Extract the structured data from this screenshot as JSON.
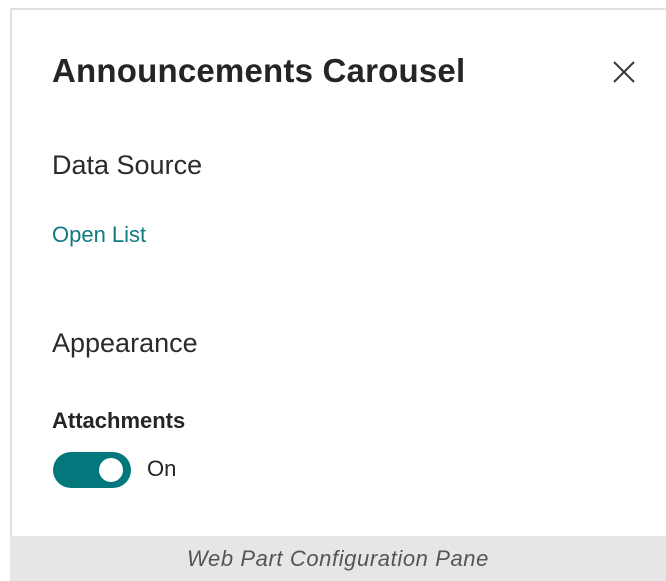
{
  "pane": {
    "title": "Announcements Carousel",
    "close_icon": "close-icon"
  },
  "data_source": {
    "heading": "Data Source",
    "link_label": "Open List"
  },
  "appearance": {
    "heading": "Appearance",
    "attachments_label": "Attachments",
    "attachments_state": "On",
    "attachments_on": true
  },
  "caption": "Web Part Configuration Pane",
  "colors": {
    "accent": "#03787c",
    "link": "#0f7c80",
    "caption_bg": "#e6e6e6",
    "text": "#252525"
  }
}
